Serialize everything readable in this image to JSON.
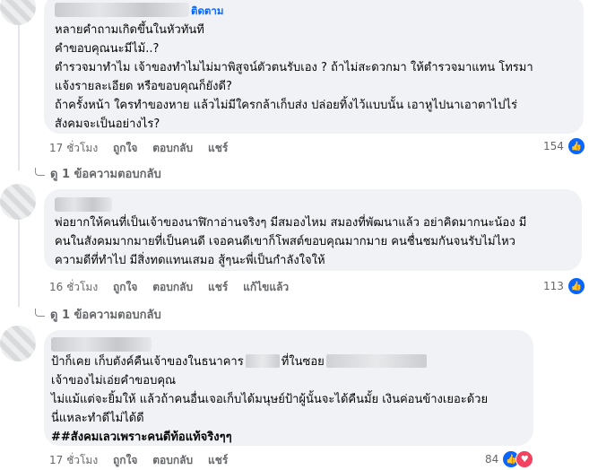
{
  "comments": [
    {
      "author_hidden": true,
      "follow_label": "ติดตาม",
      "lines": [
        "หลายคำถามเกิดขึ้นในหัวทันที",
        "คำขอบคุณนะมีไม้..?",
        "ตำรวจมาทำไม เจ้าของทำไมไม่มาพิสูจน์ตัวตนรับเอง ? ถ้าไม่สะดวกมา ให้ตำรวจมาแทน โทรมา",
        "แจ้งรายละเอียด หรือขอบคุณก็ยังดี?",
        "ถ้าครั้งหน้า ใครทำของหาย แล้วไม่มีใครกล้าเก็บส่ง ปล่อยทิ้งไว้แบบนั้น เอาหูไปนาเอาตาไปไร่",
        "สังคมจะเป็นอย่างไร?"
      ],
      "time": "17 ชั่วโมง",
      "actions": [
        "ถูกใจ",
        "ตอบกลับ",
        "แชร์"
      ],
      "reaction_count": "154",
      "replies_label": "ดู 1 ข้อความตอบกลับ"
    },
    {
      "author_hidden": true,
      "lines": [
        "พ่อยากให้คนที่เป็นเจ้าของนาฬิกาอ่านจริงๆ มีสมองไหม สมองที่พัฒนาแล้ว อย่าคิดมากนะน้อง มี",
        "คนในสังคมมากมายที่เป็นคนดี เจอคนดีเขาก็โพสต์ขอบคุณมากมาย คนชื่นชมกันจนรับไม่ไหว",
        "ความดีที่ทำไป มีสิ่งทดแทนเสมอ สู้ๆนะพี่เป็นกำลังใจให้"
      ],
      "time": "16 ชั่วโมง",
      "actions": [
        "ถูกใจ",
        "ตอบกลับ",
        "แชร์",
        "แก้ไขแล้ว"
      ],
      "reaction_count": "113",
      "replies_label": "ดู 1 ข้อความตอบกลับ"
    },
    {
      "author_hidden": true,
      "line1_a": "ป้าก็เคย เก็บตังค์คืนเจ้าของในธนาคาร",
      "line1_b": "ที่ในซอย",
      "lines_rest": [
        "เจ้าของไม่เอ่ยคำขอบคุณ",
        "ไม่แม้แต่จะยิ้มให้ แล้วถ้าคนอื่นเจอเก็บได้มนุษย์ป้าผู้นั้นจะได้คืนมั้ย เงินค่อนข้างเยอะด้วย",
        "นี่แหละทำดีไม่ได้ดี"
      ],
      "bold_line": "##สังคมเลวเพราะคนดีท้อแท้จริงๆๆ",
      "time": "17 ชั่วโมง",
      "actions": [
        "ถูกใจ",
        "ตอบกลับ",
        "แชร์"
      ],
      "reaction_count": "84"
    }
  ],
  "icons": {
    "like": "thumbs-up-icon",
    "love": "heart-icon",
    "reply_arrow": "reply-arrow-icon"
  },
  "colors": {
    "link": "#0866ff",
    "bubble": "#f0f2f5",
    "meta": "#65676b",
    "like": "#0866ff",
    "love": "#f3425f"
  }
}
